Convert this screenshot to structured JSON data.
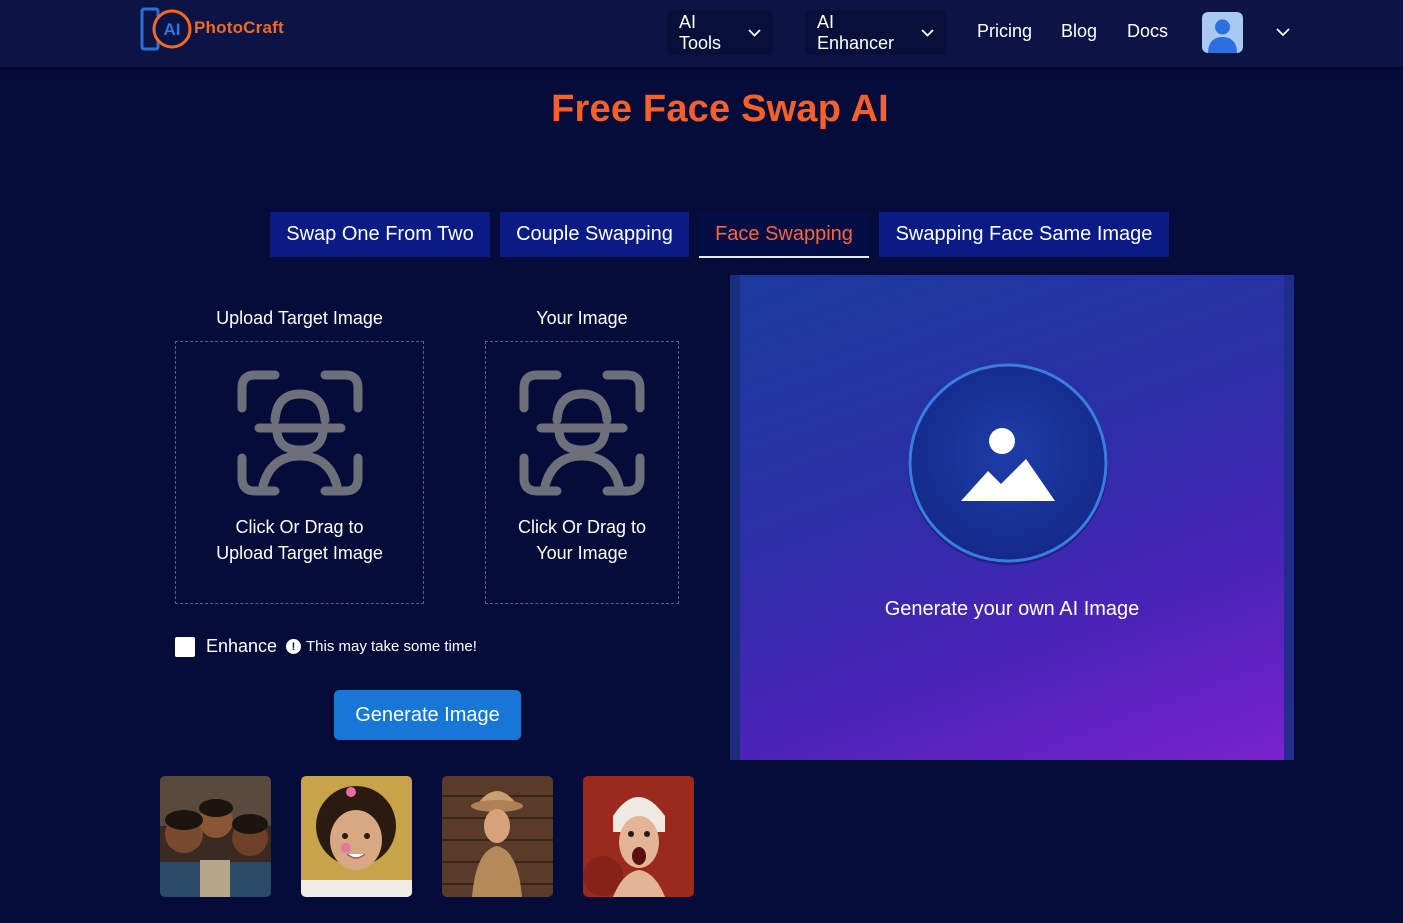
{
  "header": {
    "logo_mark": "AI",
    "logo_text": "PhotoCraft",
    "nav": [
      {
        "label": "AI Tools",
        "has_dropdown": true
      },
      {
        "label": "AI Enhancer",
        "has_dropdown": true
      },
      {
        "label": "Pricing"
      },
      {
        "label": "Blog"
      },
      {
        "label": "Docs"
      }
    ],
    "avatar_icon": "user-icon",
    "account_dropdown_icon": "chevron-down-icon"
  },
  "page": {
    "title": "Free Face Swap AI"
  },
  "tabs": [
    {
      "label": "Swap One From Two",
      "active": false
    },
    {
      "label": "Couple Swapping",
      "active": false
    },
    {
      "label": "Face Swapping",
      "active": true
    },
    {
      "label": "Swapping Face Same Image",
      "active": false
    }
  ],
  "uploads": {
    "target": {
      "label": "Upload Target Image",
      "drop_line1": "Click Or Drag to",
      "drop_line2": "Upload Target Image",
      "icon": "face-scan-icon"
    },
    "yours": {
      "label": "Your Image",
      "drop_line1": "Click Or Drag to",
      "drop_line2": "Your Image",
      "icon": "face-scan-icon"
    }
  },
  "enhance": {
    "label": "Enhance",
    "checked": false,
    "note": "This may take some time!",
    "note_icon": "info-icon"
  },
  "generate_button": "Generate Image",
  "samples": [
    {
      "icon": "sample-photo-children"
    },
    {
      "icon": "sample-photo-girl"
    },
    {
      "icon": "sample-photo-man-with-hat"
    },
    {
      "icon": "sample-photo-woman-screaming"
    }
  ],
  "result": {
    "text": "Generate your own AI Image",
    "icon": "image-icon"
  },
  "colors": {
    "background": "#060c3a",
    "header": "#0b1445",
    "accent_orange": "#f8602a",
    "tab": "#0a1b86",
    "button_blue": "#1677d6"
  }
}
